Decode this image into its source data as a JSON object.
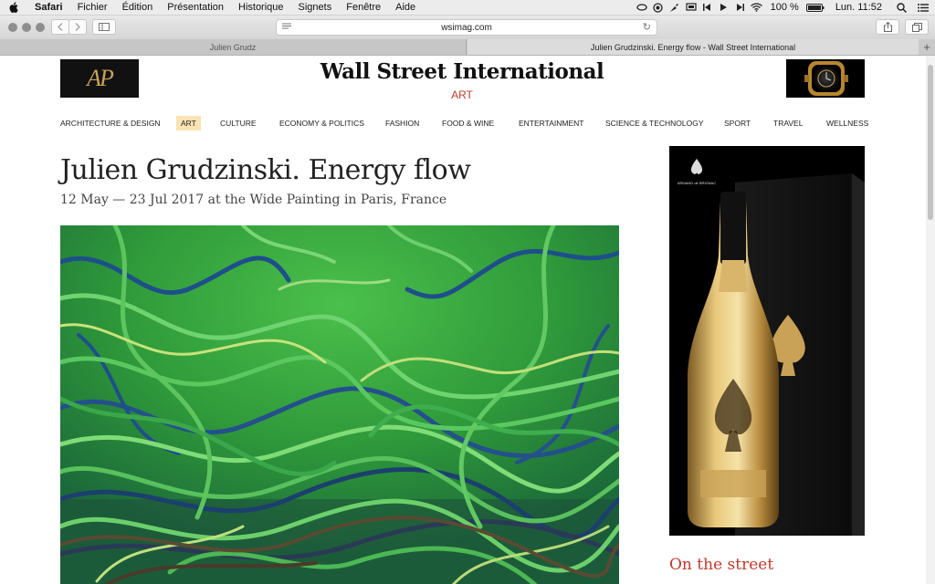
{
  "menubar": {
    "items": [
      "Safari",
      "Fichier",
      "Édition",
      "Présentation",
      "Historique",
      "Signets",
      "Fenêtre",
      "Aide"
    ],
    "battery": "100 %",
    "clock": "Lun. 11:52"
  },
  "toolbar": {
    "url": "wsimag.com"
  },
  "tabs": [
    {
      "label": "Julien Grudz"
    },
    {
      "label": "Julien Grudzinski. Energy flow - Wall Street International"
    }
  ],
  "site": {
    "logo": "Wall Street International",
    "section": "ART",
    "ad_left_text": "AP",
    "nav": [
      "ARCHITECTURE & DESIGN",
      "ART",
      "CULTURE",
      "ECONOMY & POLITICS",
      "FASHION",
      "FOOD & WINE",
      "ENTERTAINMENT",
      "SCIENCE & TECHNOLOGY",
      "SPORT",
      "TRAVEL",
      "WELLNESS"
    ],
    "active_nav": "ART"
  },
  "article": {
    "title": "Julien Grudzinski. Energy flow",
    "subtitle": "12 May — 23 Jul 2017 at the Wide Painting in Paris, France"
  },
  "sidebar": {
    "ad_brand": "ARMAND de BRIGNAC",
    "heading": "On the street"
  },
  "colors": {
    "accent": "#c0392b",
    "active_nav_bg": "#fbe3b4"
  }
}
